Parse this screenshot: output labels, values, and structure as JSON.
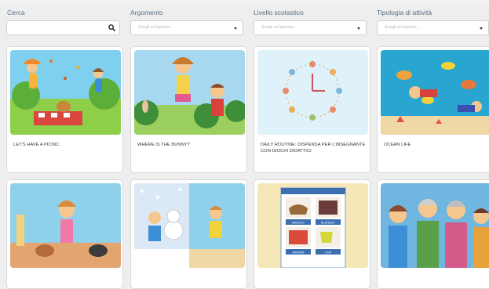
{
  "filters": {
    "search": {
      "label": "Cerca",
      "value": ""
    },
    "topic": {
      "label": "Argomento",
      "placeholder": "Scegli un'opzione..."
    },
    "level": {
      "label": "Livello scolastico",
      "placeholder": "Scegli un'opzione..."
    },
    "activity_type": {
      "label": "Tipologia di attività",
      "placeholder": "Scegli un'opzione..."
    }
  },
  "cards": [
    {
      "title": "LET'S HAVE A PICNIC"
    },
    {
      "title": "WHERE IS THE BUNNY?"
    },
    {
      "title": "DAILY ROUTINE: DISPENSA PER L'INSEGNANTE CON GIOCHI DIDATTICI"
    },
    {
      "title": "OCEAN LIFE"
    },
    {
      "title": ""
    },
    {
      "title": ""
    },
    {
      "title": "",
      "thumb_words": [
        "BASKET",
        "BLANKET",
        "NAPKIN",
        "CUP"
      ]
    },
    {
      "title": ""
    }
  ]
}
